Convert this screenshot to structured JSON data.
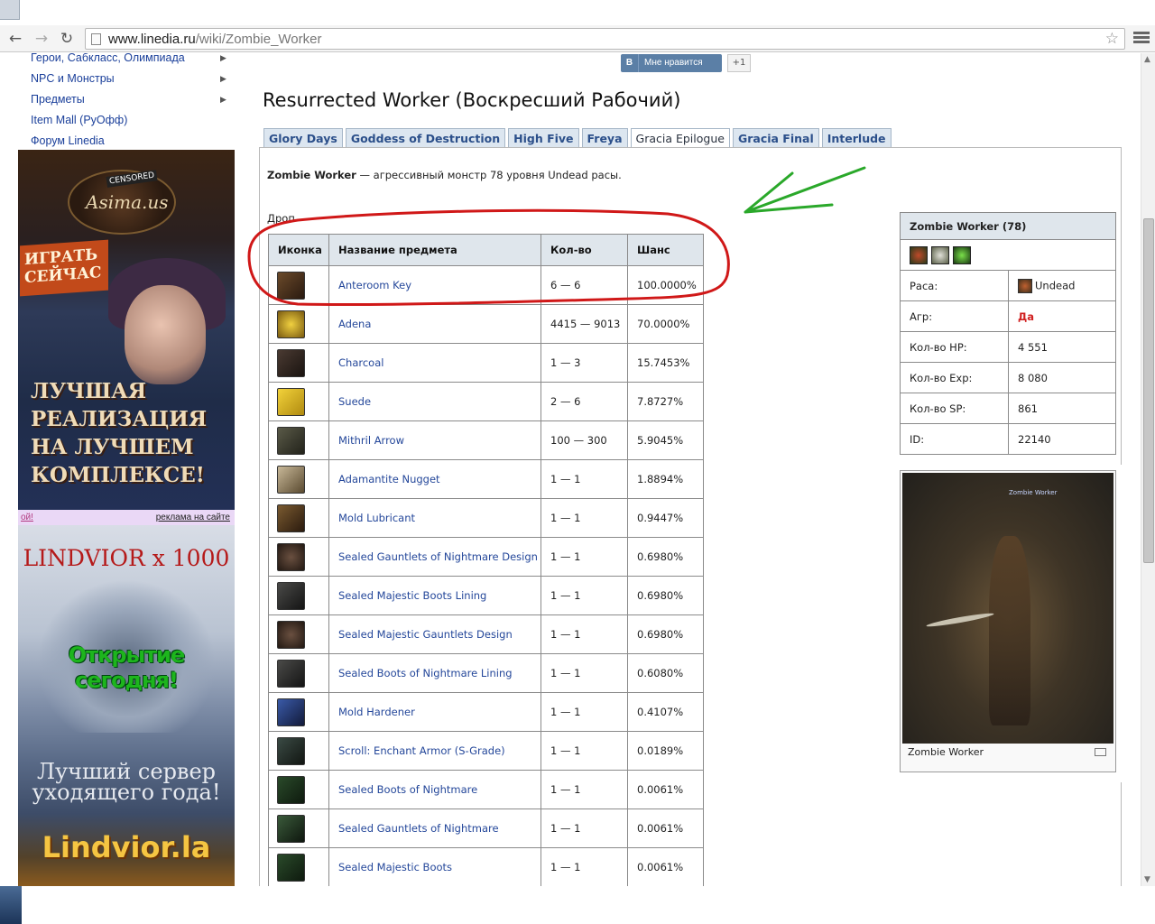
{
  "browser": {
    "url_host": "www.linedia.ru",
    "url_path": "/wiki/Zombie_Worker",
    "back_icon": "arrow-left-icon",
    "forward_icon": "arrow-right-icon",
    "reload_icon": "reload-icon"
  },
  "sidebar": {
    "items": [
      {
        "label": "Герои, Сабкласс, Олимпиада"
      },
      {
        "label": "NPC и Монстры"
      },
      {
        "label": "Предметы"
      },
      {
        "label": "Item Mall (РуОфф)"
      },
      {
        "label": "Форум Linedia"
      }
    ]
  },
  "ads": {
    "banner1": {
      "censored": "CENSORED",
      "logo": "Asima.us",
      "play": "ИГРАТЬ СЕЙЧАС",
      "slogan_1": "ЛУЧШАЯ",
      "slogan_2": "РЕАЛИЗАЦИЯ",
      "slogan_3": "НА ЛУЧШЕМ",
      "slogan_4": "КОМПЛЕКСЕ!"
    },
    "links": {
      "left": "ой!",
      "right": "реклама на сайте"
    },
    "banner2": {
      "title": "LINDVIOR x 1000",
      "open": "Открытие сегодня!",
      "best_1": "Лучший сервер",
      "best_2": "уходящего года!",
      "site": "Lindvior.la"
    }
  },
  "social": {
    "vk_letter": "В",
    "vk_label": "Мне нравится",
    "plus_one": "+1"
  },
  "page": {
    "title": "Resurrected Worker (Воскресший Рабочий)",
    "tabs": [
      "Glory Days",
      "Goddess of Destruction",
      "High Five",
      "Freya",
      "Gracia Epilogue",
      "Gracia Final",
      "Interlude"
    ],
    "active_tab": "Gracia Epilogue",
    "intro_name": "Zombie Worker",
    "intro_rest": " — агрессивный монстр 78 уровня Undead расы.",
    "drop_label": "Дроп"
  },
  "drop_table": {
    "headers": [
      "Иконка",
      "Название предмета",
      "Кол-во",
      "Шанс"
    ],
    "rows": [
      {
        "icon": "key-icon",
        "name": "Anteroom Key",
        "qty": "6 — 6",
        "chance": "100.0000%"
      },
      {
        "icon": "adena-icon",
        "name": "Adena",
        "qty": "4415 — 9013",
        "chance": "70.0000%"
      },
      {
        "icon": "charcoal-icon",
        "name": "Charcoal",
        "qty": "1 — 3",
        "chance": "15.7453%"
      },
      {
        "icon": "suede-icon",
        "name": "Suede",
        "qty": "2 — 6",
        "chance": "7.8727%"
      },
      {
        "icon": "arrow-bundle-icon",
        "name": "Mithril Arrow",
        "qty": "100 — 300",
        "chance": "5.9045%"
      },
      {
        "icon": "nugget-icon",
        "name": "Adamantite Nugget",
        "qty": "1 — 1",
        "chance": "1.8894%"
      },
      {
        "icon": "lubricant-icon",
        "name": "Mold Lubricant",
        "qty": "1 — 1",
        "chance": "0.9447%"
      },
      {
        "icon": "sack-icon",
        "name": "Sealed Gauntlets of Nightmare Design",
        "qty": "1 — 1",
        "chance": "0.6980%"
      },
      {
        "icon": "lining-icon",
        "name": "Sealed Majestic Boots Lining",
        "qty": "1 — 1",
        "chance": "0.6980%"
      },
      {
        "icon": "sack-icon",
        "name": "Sealed Majestic Gauntlets Design",
        "qty": "1 — 1",
        "chance": "0.6980%"
      },
      {
        "icon": "lining-icon",
        "name": "Sealed Boots of Nightmare Lining",
        "qty": "1 — 1",
        "chance": "0.6080%"
      },
      {
        "icon": "hardener-icon",
        "name": "Mold Hardener",
        "qty": "1 — 1",
        "chance": "0.4107%"
      },
      {
        "icon": "scroll-icon",
        "name": "Scroll: Enchant Armor (S-Grade)",
        "qty": "1 — 1",
        "chance": "0.0189%"
      },
      {
        "icon": "boots-icon",
        "name": "Sealed Boots of Nightmare",
        "qty": "1 — 1",
        "chance": "0.0061%"
      },
      {
        "icon": "gauntlets-icon",
        "name": "Sealed Gauntlets of Nightmare",
        "qty": "1 — 1",
        "chance": "0.0061%"
      },
      {
        "icon": "boots-icon",
        "name": "Sealed Majestic Boots",
        "qty": "1 — 1",
        "chance": "0.0061%"
      }
    ]
  },
  "infobox": {
    "title": "Zombie Worker (78)",
    "rows": [
      {
        "label": "Раса:",
        "value": "Undead"
      },
      {
        "label": "Агр:",
        "value": "Да"
      },
      {
        "label": "Кол-во HP:",
        "value": "4 551"
      },
      {
        "label": "Кол-во Exp:",
        "value": "8 080"
      },
      {
        "label": "Кол-во SP:",
        "value": "861"
      },
      {
        "label": "ID:",
        "value": "22140"
      }
    ]
  },
  "thumbnail": {
    "caption": "Zombie Worker",
    "nameplate": "Zombie Worker"
  },
  "colors": {
    "link": "#24479a",
    "tab_text": "#2b4f8a",
    "annotation_red": "#d01818",
    "annotation_green": "#2aa82a"
  }
}
